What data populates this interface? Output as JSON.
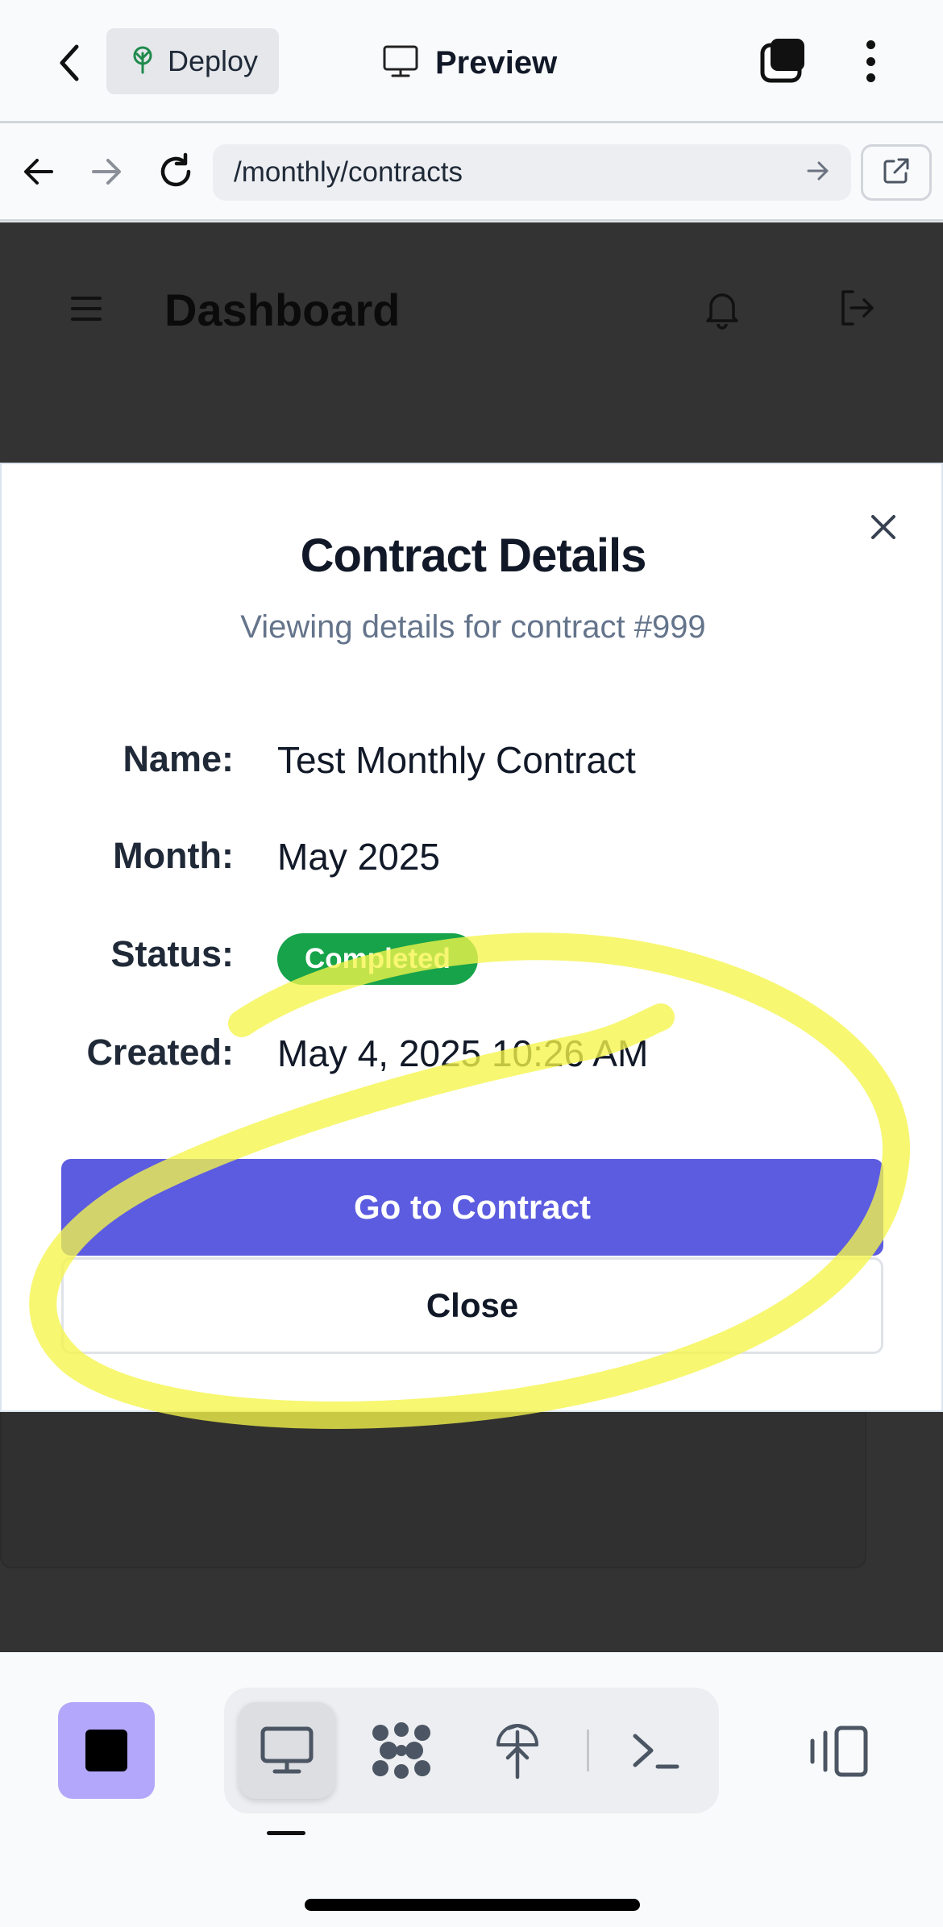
{
  "appbar": {
    "deploy_label": "Deploy",
    "preview_label": "Preview"
  },
  "urlbar": {
    "url": "/monthly/contracts"
  },
  "background_app": {
    "title": "Dashboard"
  },
  "modal": {
    "title": "Contract Details",
    "subtitle": "Viewing details for contract #999",
    "fields": {
      "name_label": "Name:",
      "name_value": "Test Monthly Contract",
      "month_label": "Month:",
      "month_value": "May 2025",
      "status_label": "Status:",
      "status_value": "Completed",
      "created_label": "Created:",
      "created_value": "May 4, 2025 10:26 AM"
    },
    "primary_button": "Go to Contract",
    "secondary_button": "Close"
  },
  "colors": {
    "primary": "#5c5ce0",
    "status_completed": "#16a34a",
    "highlight": "#f5f54a",
    "stop_button": "#b3a7fb"
  },
  "icons": {
    "appbar": [
      "chevron-left-icon",
      "deploy-tree-icon",
      "monitor-icon",
      "tabs-icon",
      "more-vertical-icon"
    ],
    "urlbar": [
      "arrow-left-icon",
      "arrow-right-icon",
      "reload-icon",
      "go-arrow-icon",
      "external-link-icon"
    ],
    "header": [
      "menu-icon",
      "bell-icon",
      "logout-icon"
    ],
    "toolbar": [
      "stop-icon",
      "monitor-icon",
      "grid-icon",
      "deploy-tree-icon",
      "terminal-icon",
      "panel-icon"
    ]
  }
}
